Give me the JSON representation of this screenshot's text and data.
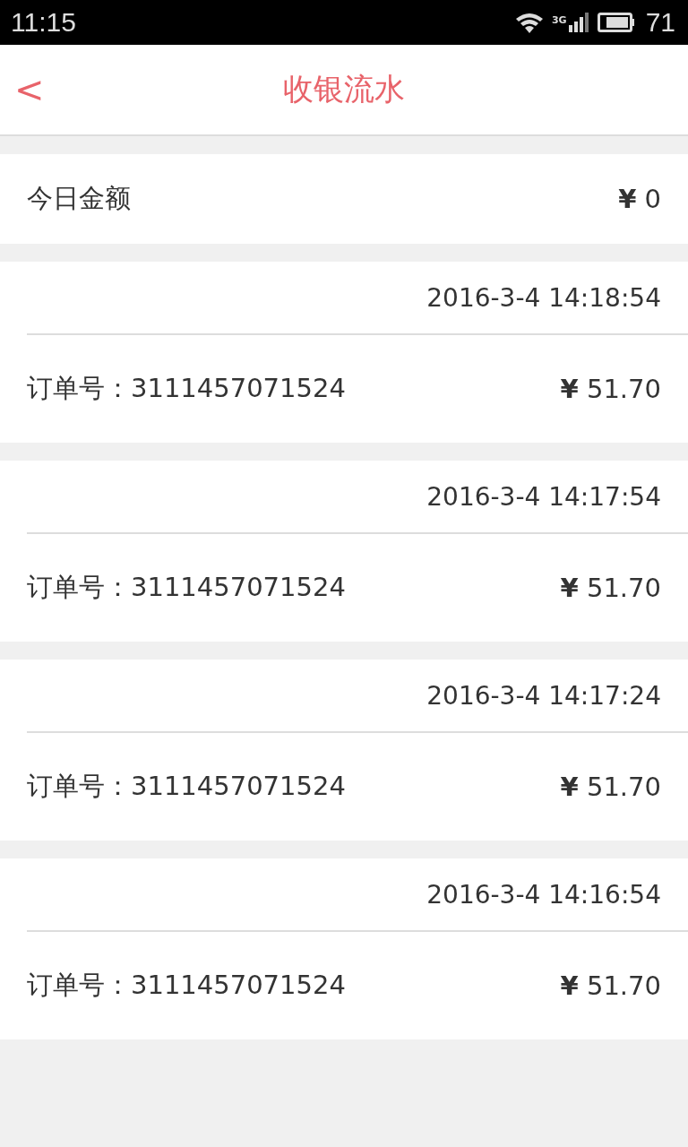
{
  "status_bar": {
    "time": "11:15",
    "network": "3G",
    "battery": "71"
  },
  "header": {
    "back": "<",
    "title": "收银流水"
  },
  "today": {
    "label": "今日金额",
    "amount": "**¥** 0"
  },
  "orders": [
    {
      "time": "2016-3-4 14:18:54",
      "order_no": "订单号：3111457071524",
      "amount": "**¥** 51.70"
    },
    {
      "time": "2016-3-4 14:17:54",
      "order_no": "订单号：3111457071524",
      "amount": "**¥** 51.70"
    },
    {
      "time": "2016-3-4 14:17:24",
      "order_no": "订单号：3111457071524",
      "amount": "**¥** 51.70"
    },
    {
      "time": "2016-3-4 14:16:54",
      "order_no": "订单号：3111457071524",
      "amount": "**¥** 51.70"
    }
  ]
}
